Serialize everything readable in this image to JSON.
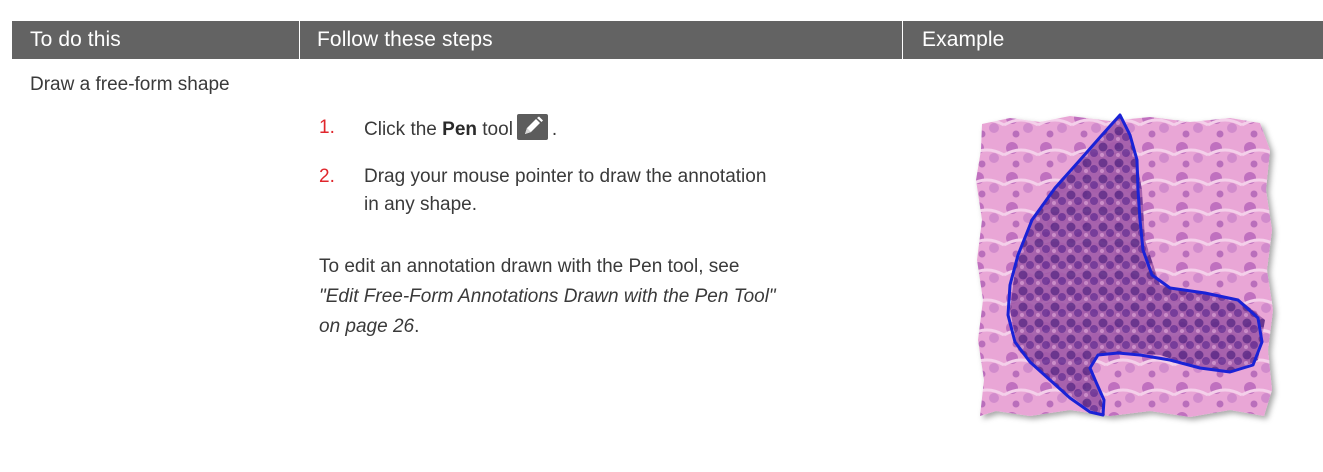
{
  "header": {
    "col1": "To do this",
    "col2": "Follow these steps",
    "col3": "Example"
  },
  "row": {
    "label": "Draw a free-form shape",
    "steps": [
      {
        "num": "1.",
        "text_before": "Click the ",
        "bold": "Pen",
        "text_after": " tool",
        "icon": "pen-icon",
        "trailing": "."
      },
      {
        "num": "2.",
        "line1": "Drag your mouse pointer to draw the annotation",
        "line2": "in any shape."
      }
    ],
    "note": {
      "line1": "To edit an annotation drawn with the Pen tool, see",
      "link_line1": "\"Edit Free-Form Annotations Drawn with the Pen Tool\"",
      "link_line2": "on page 26",
      "trailing": "."
    }
  },
  "example": {
    "icon": "tissue-annotation-image",
    "annotation_color": "#1a22d6"
  }
}
